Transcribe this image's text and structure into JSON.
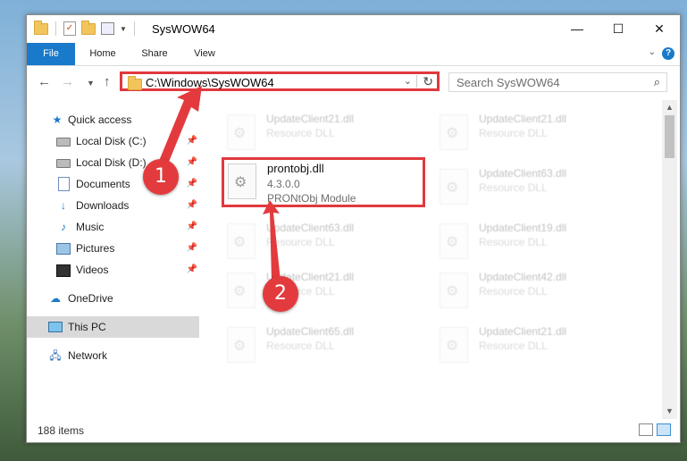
{
  "window": {
    "title": "SysWOW64",
    "controls": {
      "minimize": "—",
      "maximize": "☐",
      "close": "✕"
    }
  },
  "ribbon": {
    "tabs": [
      "File",
      "Home",
      "Share",
      "View"
    ],
    "help": "?"
  },
  "nav": {
    "address_path": "C:\\Windows\\SysWOW64",
    "search_placeholder": "Search SysWOW64"
  },
  "sidebar": {
    "items": [
      {
        "label": "Quick access",
        "icon": "star-icon",
        "pinned": false
      },
      {
        "label": "Local Disk (C:)",
        "icon": "drive-icon",
        "pinned": true
      },
      {
        "label": "Local Disk (D:)",
        "icon": "drive-icon",
        "pinned": true
      },
      {
        "label": "Documents",
        "icon": "documents-icon",
        "pinned": true
      },
      {
        "label": "Downloads",
        "icon": "downloads-icon",
        "pinned": true
      },
      {
        "label": "Music",
        "icon": "music-icon",
        "pinned": true
      },
      {
        "label": "Pictures",
        "icon": "pictures-icon",
        "pinned": true
      },
      {
        "label": "Videos",
        "icon": "videos-icon",
        "pinned": true
      },
      {
        "label": "OneDrive",
        "icon": "onedrive-icon",
        "pinned": false
      },
      {
        "label": "This PC",
        "icon": "this-pc-icon",
        "pinned": false,
        "selected": true
      },
      {
        "label": "Network",
        "icon": "network-icon",
        "pinned": false
      }
    ]
  },
  "files": {
    "left": [
      {
        "name": "UpdateClient21.dll",
        "desc": "Resource DLL"
      },
      {
        "name": "prontobj.dll",
        "version": "4.3.0.0",
        "desc": "PRONtObj Module",
        "highlighted": true
      },
      {
        "name": "UpdateClient63.dll",
        "desc": "Resource DLL"
      },
      {
        "name": "UpdateClient21.dll",
        "desc": "Resource DLL"
      },
      {
        "name": "UpdateClient65.dll",
        "desc": "Resource DLL"
      }
    ],
    "right": [
      {
        "name": "UpdateClient21.dll",
        "desc": "Resource DLL"
      },
      {
        "name": "UpdateClient63.dll",
        "desc": "Resource DLL"
      },
      {
        "name": "UpdateClient19.dll",
        "desc": "Resource DLL"
      },
      {
        "name": "UpdateClient42.dll",
        "desc": "Resource DLL"
      },
      {
        "name": "UpdateClient21.dll",
        "desc": "Resource DLL"
      }
    ]
  },
  "status": {
    "item_count": "188 items"
  },
  "callouts": [
    "1",
    "2"
  ],
  "colors": {
    "accent": "#1979ca",
    "highlight": "#e0393e"
  }
}
